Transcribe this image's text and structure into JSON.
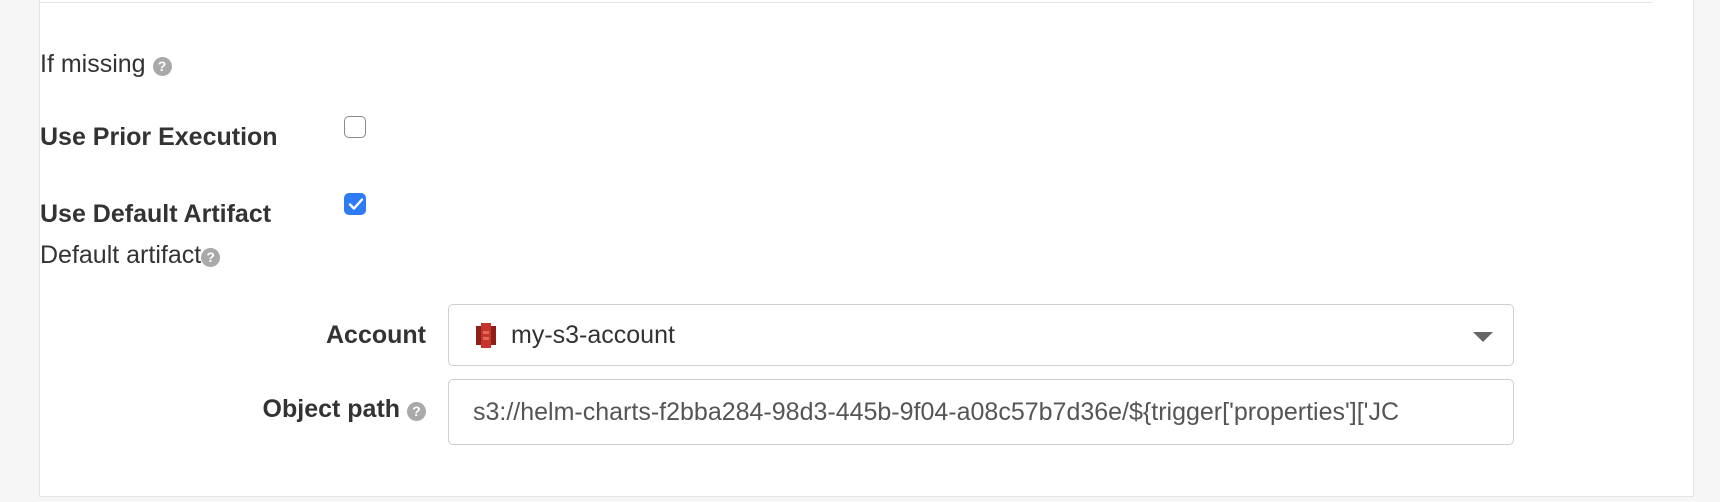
{
  "form": {
    "if_missing": {
      "label": "If missing",
      "help_icon": "question-circle-icon"
    },
    "use_prior_execution": {
      "label": "Use Prior Execution",
      "checked": false
    },
    "use_default_artifact": {
      "label": "Use Default Artifact",
      "checked": true
    },
    "default_artifact": {
      "label": "Default artifact",
      "help_icon": "question-circle-icon"
    },
    "account": {
      "label": "Account",
      "value": "my-s3-account",
      "icon": "s3-bucket-icon"
    },
    "object_path": {
      "label": "Object path",
      "value": "s3://helm-charts-f2bba284-98d3-445b-9f04-a08c57b7d36e/${trigger['properties']['JC",
      "help_icon": "question-circle-icon"
    }
  },
  "colors": {
    "checkbox_checked": "#2f7bf5",
    "s3_icon": "#c7332d"
  }
}
